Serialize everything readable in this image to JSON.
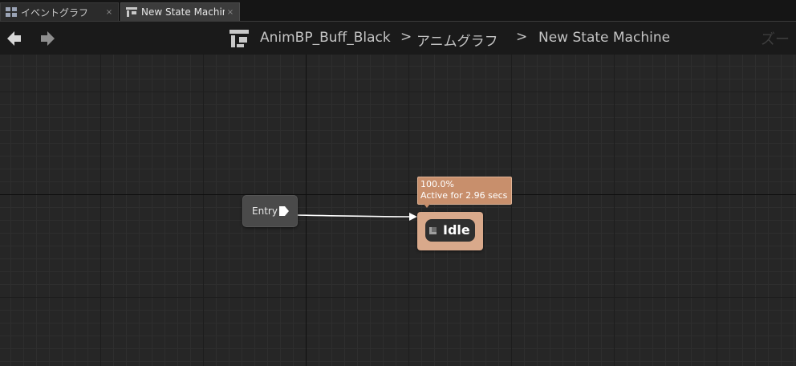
{
  "tabs": [
    {
      "label": "イベントグラフ",
      "icon": "event-graph-icon",
      "close": "×",
      "active": false
    },
    {
      "label": "New State Machine",
      "icon": "state-machine-icon",
      "close": "×",
      "active": true
    }
  ],
  "nav": {
    "back_icon": "back-arrow-icon",
    "forward_icon": "forward-arrow-icon",
    "breadcrumb_icon": "state-machine-icon",
    "breadcrumb": [
      "AnimBP_Buff_Black",
      "アニムグラフ",
      "New State Machine"
    ],
    "separator": ">",
    "zoom_label": "ズー"
  },
  "graph": {
    "entry_node": {
      "label": "Entry",
      "pin_icon": "exec-pin-icon"
    },
    "idle_node": {
      "label": "Idle",
      "icon": "state-icon"
    },
    "tooltip": {
      "line1": "100.0%",
      "line2": "Active for 2.96 secs"
    }
  },
  "colors": {
    "state_node": "#d9a98b",
    "tooltip_bg": "#c88f6c",
    "wire": "#ffffff",
    "graph_bg": "#262626"
  }
}
